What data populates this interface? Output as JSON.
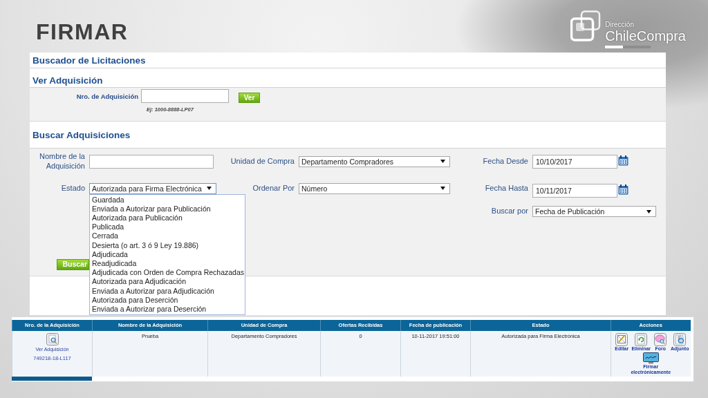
{
  "slide": {
    "title": "FIRMAR",
    "logo": {
      "subtitle": "Dirección",
      "name": "ChileCompra"
    }
  },
  "page": {
    "title": "Buscador de Licitaciones"
  },
  "ver_adquisicion": {
    "heading": "Ver Adquisición",
    "label": "Nro. de Adquisición",
    "hint": "Ej: 1000-8888-LP07",
    "button": "Ver"
  },
  "search": {
    "heading": "Buscar Adquisiciones",
    "rows": [
      {
        "fields": [
          {
            "kind": "text",
            "label": "Nombre de la Adquisición"
          },
          {
            "kind": "select",
            "label": "Unidad de Compra",
            "value": "Departamento Compradores",
            "expanded": false
          },
          {
            "kind": "date",
            "label": "Fecha Desde",
            "value": "10/10/2017"
          }
        ]
      },
      {
        "fields": [
          {
            "kind": "select",
            "label": "Estado",
            "value": "Autorizada para Firma Electrónica",
            "expanded": true,
            "options": [
              "Guardada",
              "Enviada a Autorizar para Publicación",
              "Autorizada para Publicación",
              "Publicada",
              "Cerrada",
              "Desierta (o art. 3 ó 9 Ley 19.886)",
              "Adjudicada",
              "Readjudicada",
              "Adjudicada con Orden de Compra Rechazadas",
              "Autorizada para Adjudicación",
              "Enviada a Autorizar para Adjudicación",
              "Autorizada para Deserción",
              "Enviada a Autorizar para Deserción"
            ]
          },
          {
            "kind": "select",
            "label": "Ordenar Por",
            "value": "Número",
            "expanded": false
          },
          {
            "kind": "date",
            "label": "Fecha Hasta",
            "value": "10/11/2017"
          }
        ]
      },
      {
        "fields": [
          {
            "kind": "select",
            "label": "Buscar por",
            "value": "Fecha de Publicación",
            "expanded": false
          }
        ]
      }
    ],
    "button": "Buscar"
  },
  "results": {
    "columns": [
      "Nro. de la Adquisición",
      "Nombre de la Adquisición",
      "Unidad de Compra",
      "Ofertas Recibidas",
      "Fecha de publicación",
      "Estado",
      "Acciones"
    ],
    "rows": [
      {
        "view_link": "Ver Adquisición",
        "number": "749218-18-L117",
        "name": "Prueba",
        "unit": "Departamento Compradores",
        "offers": "0",
        "published": "10-11-2017 19:51:00",
        "status": "Autorizada para Firma Electrónica",
        "actions": [
          {
            "kind": "edit",
            "label": "Editar"
          },
          {
            "kind": "delete",
            "label": "Eliminar"
          },
          {
            "kind": "forum",
            "label": "Foro"
          },
          {
            "kind": "attach",
            "label": "Adjunto"
          },
          {
            "kind": "sign",
            "label": "Firmar electrónicamente"
          }
        ]
      }
    ]
  }
}
